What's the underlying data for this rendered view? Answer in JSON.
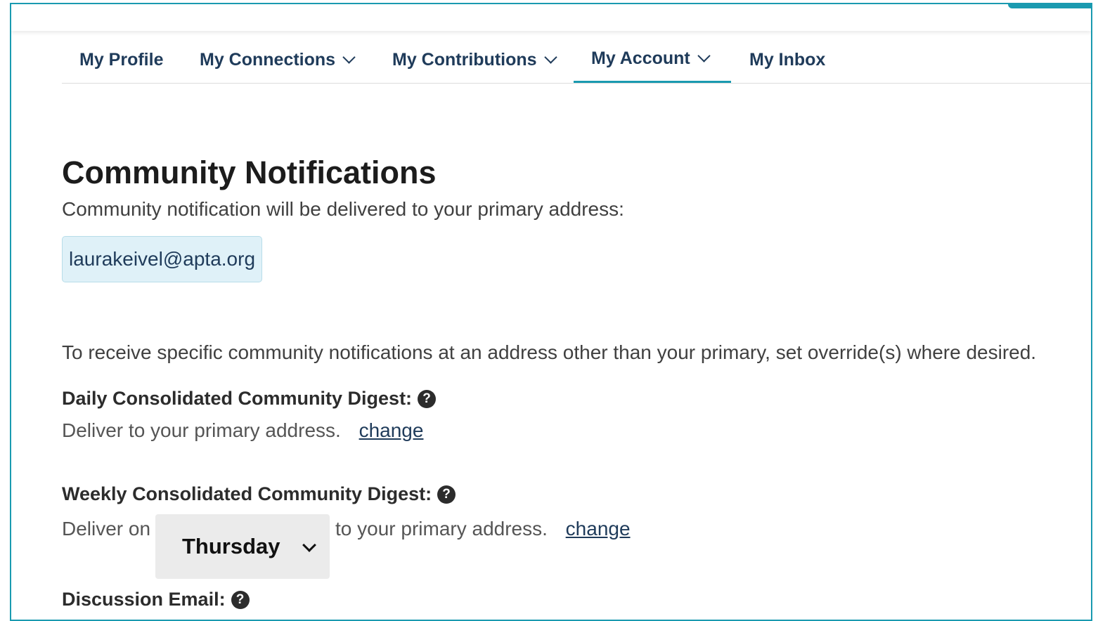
{
  "nav": {
    "items": [
      {
        "label": "My Profile",
        "has_dropdown": false,
        "active": false
      },
      {
        "label": "My Connections",
        "has_dropdown": true,
        "active": false
      },
      {
        "label": "My Contributions",
        "has_dropdown": true,
        "active": false
      },
      {
        "label": "My Account",
        "has_dropdown": true,
        "active": true
      },
      {
        "label": "My Inbox",
        "has_dropdown": false,
        "active": false
      }
    ]
  },
  "page": {
    "title": "Community Notifications",
    "subtitle": "Community notification will be delivered to your primary address:",
    "primary_email": "laurakeivel@apta.org",
    "override_info": "To receive specific community notifications at an address other than your primary, set override(s) where desired."
  },
  "daily_digest": {
    "label": "Daily Consolidated Community Digest:",
    "help_icon": "question-circle-icon",
    "deliver_text": "Deliver to your primary address.",
    "change_label": "change"
  },
  "weekly_digest": {
    "label": "Weekly Consolidated Community Digest:",
    "help_icon": "question-circle-icon",
    "deliver_prefix": "Deliver on",
    "day_selected": "Thursday",
    "deliver_suffix": "to your primary address.",
    "change_label": "change"
  },
  "discussion_email": {
    "label": "Discussion Email:",
    "help_icon": "question-circle-icon"
  },
  "colors": {
    "accent": "#1a9ab0",
    "nav_text": "#1f3b5a",
    "email_chip_bg": "#dff1f8"
  }
}
